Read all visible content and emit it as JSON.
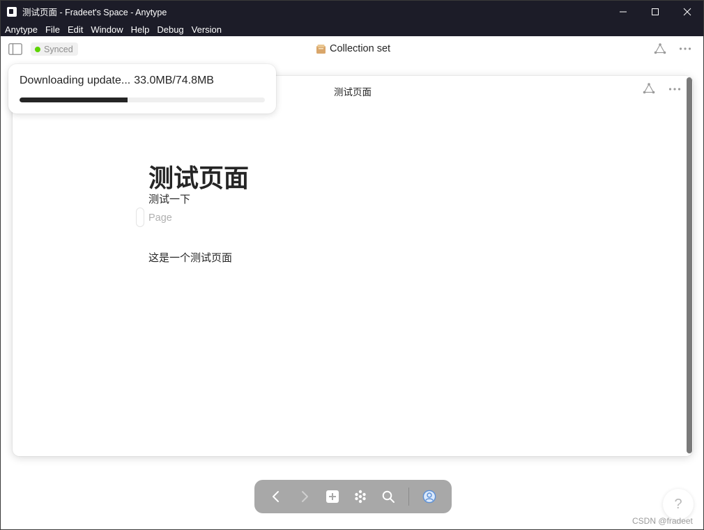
{
  "window": {
    "title": "测试页面 - Fradeet's Space - Anytype",
    "controls": [
      "minimize-icon",
      "maximize-icon",
      "close-icon"
    ]
  },
  "menu": [
    "Anytype",
    "File",
    "Edit",
    "Window",
    "Help",
    "Debug",
    "Version"
  ],
  "header": {
    "sync_status": "Synced",
    "sync_color": "#5dd400",
    "collection_icon": "collection-set-icon",
    "collection_title": "Collection set"
  },
  "popup": {
    "title": "测试页面",
    "doc_title": "测试页面",
    "doc_description": "测试一下",
    "doc_type": "Page",
    "doc_body": "这是一个测试页面"
  },
  "update": {
    "label": "Downloading update...",
    "progress_text": "33.0MB/74.8MB",
    "downloaded_mb": 33.0,
    "total_mb": 74.8
  },
  "navbar": {
    "buttons": [
      "back-icon",
      "forward-icon",
      "plus-icon",
      "graph-icon",
      "search-icon",
      "profile-icon"
    ]
  },
  "help_label": "?",
  "watermark": "CSDN @fradeet"
}
